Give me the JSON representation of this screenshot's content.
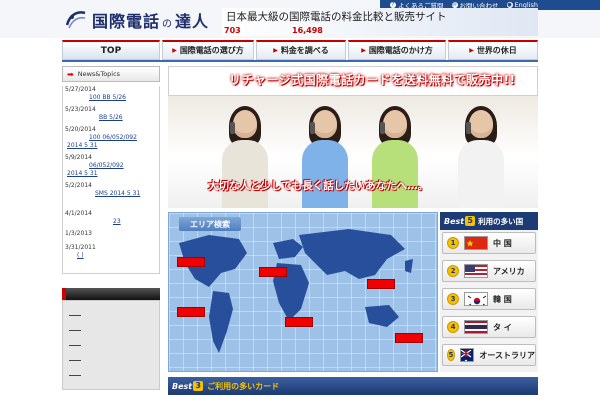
{
  "header": {
    "logo": {
      "kanji": "国際電話",
      "particle": "の",
      "suffix": "達人"
    },
    "tagline": "日本最大級の国際電話の料金比較と販売サイト",
    "stat_a": "703",
    "stat_b": "16,498",
    "toplinks": [
      {
        "label": "よくあるご質問",
        "icon": "question-icon"
      },
      {
        "label": "お問い合わせ",
        "icon": "mail-icon"
      },
      {
        "label": "English",
        "icon": "globe-icon"
      }
    ]
  },
  "nav": {
    "tabs": [
      {
        "label": "TOP"
      },
      {
        "label": "国際電話の選び方"
      },
      {
        "label": "料金を調べる"
      },
      {
        "label": "国際電話のかけ方"
      },
      {
        "label": "世界の休日"
      }
    ]
  },
  "sidebar": {
    "news_title": "News&Topics",
    "news": [
      {
        "date": "5/27/2014",
        "line1": "100  BB  5/26",
        "line2": ""
      },
      {
        "date": "5/23/2014",
        "line1": "BB  5/26",
        "line2": ""
      },
      {
        "date": "5/20/2014",
        "line1": "100 06/052/092",
        "line2": "2014 5 31"
      },
      {
        "date": "5/9/2014",
        "line1": "06/052/092",
        "line2": "2014 5 31"
      },
      {
        "date": "5/2/2014",
        "line1": "SMS 2014 5 31",
        "line2": ""
      },
      {
        "date": "4/1/2014",
        "line1": "23",
        "line2": ""
      },
      {
        "date": "1/3/2013",
        "line1": "",
        "line2": ""
      },
      {
        "date": "3/31/2011",
        "line1": "(    )",
        "line2": ""
      }
    ]
  },
  "banner": {
    "title": "リチャージ式国際電話カードを送料無料で販売中!!",
    "subtitle": "大切な人と少しでも長く話したいあなたへ…。"
  },
  "map": {
    "label": "エリア検索"
  },
  "ranking": {
    "best": "Best",
    "rank_count": "5",
    "title": "利用の多い国",
    "items": [
      {
        "rank": "1",
        "name": "中 国",
        "flag": "china-flag"
      },
      {
        "rank": "2",
        "name": "アメリカ",
        "flag": "usa-flag"
      },
      {
        "rank": "3",
        "name": "韓 国",
        "flag": "korea-flag"
      },
      {
        "rank": "4",
        "name": "タ イ",
        "flag": "thailand-flag"
      },
      {
        "rank": "5",
        "name": "オーストラリア",
        "flag": "australia-flag"
      }
    ]
  },
  "cards": {
    "best": "Best",
    "rank_count": "3",
    "title": "ご利用の多いカード"
  },
  "colors": {
    "brand_navy": "#1c3a74",
    "accent_red": "#d10000",
    "gold": "#f5c100"
  }
}
